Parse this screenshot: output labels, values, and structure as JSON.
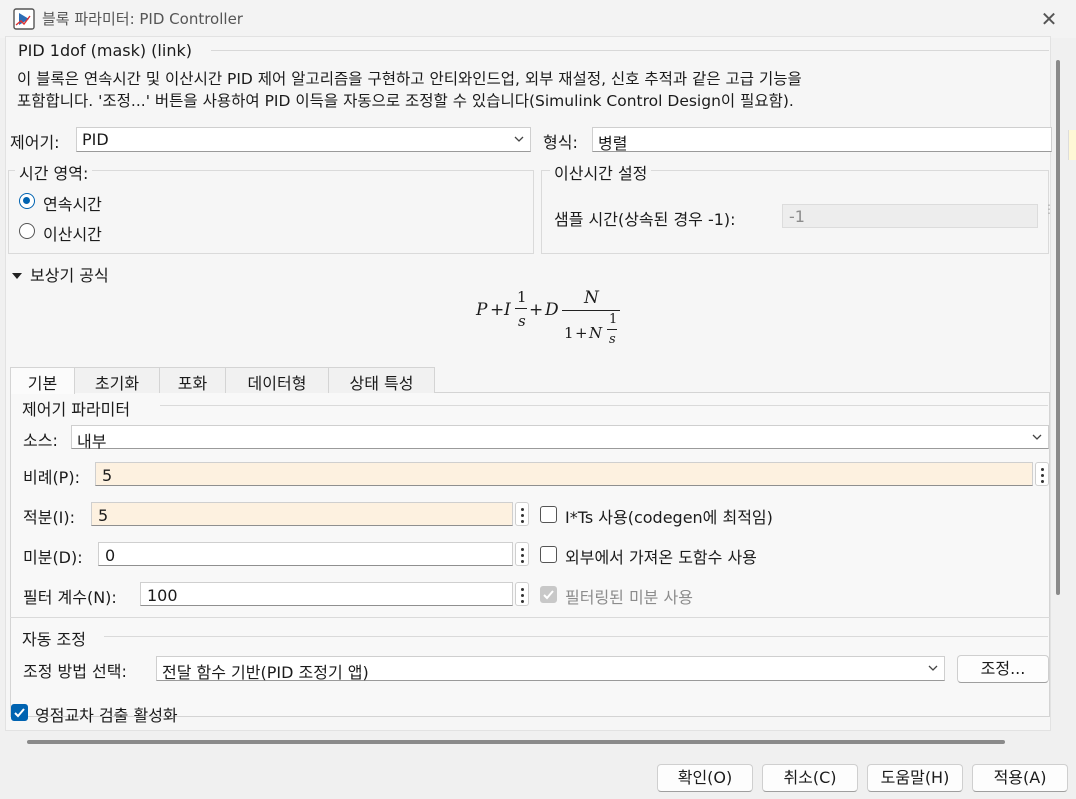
{
  "window": {
    "title": "블록 파라미터: PID Controller",
    "icon": "simulink-block-icon",
    "close_icon": "close-icon"
  },
  "header": {
    "block_name": "PID 1dof (mask) (link)",
    "description_line1": "이 블록은 연속시간 및 이산시간 PID 제어 알고리즘을 구현하고 안티와인드업, 외부 재설정, 신호 추적과 같은 고급 기능을",
    "description_line2": "포함합니다. '조정...' 버튼을 사용하여 PID 이득을 자동으로 조정할 수 있습니다(Simulink Control Design이 필요함)."
  },
  "controller": {
    "label": "제어기:",
    "value": "PID",
    "form_label": "형식:",
    "form_value": "병렬"
  },
  "time_domain": {
    "title": "시간 영역:",
    "options": [
      "연속시간",
      "이산시간"
    ],
    "selected": "연속시간"
  },
  "discrete_settings": {
    "title": "이산시간 설정",
    "sample_time_label": "샘플 시간(상속된 경우 -1):",
    "sample_time_value": "-1"
  },
  "compensator": {
    "title": "보상기 공식",
    "formula": {
      "p": "P",
      "plus1": "+",
      "i": "I",
      "one1": "1",
      "s1": "s",
      "plus2": "+",
      "d": "D",
      "n_top": "N",
      "den_one": "1",
      "den_plus": "+",
      "den_n": "N",
      "one2": "1",
      "s2": "s"
    }
  },
  "tabs": [
    "기본",
    "초기화",
    "포화",
    "데이터형",
    "상태 특성"
  ],
  "active_tab": "기본",
  "params": {
    "title": "제어기 파라미터",
    "source_label": "소스:",
    "source_value": "내부",
    "p_label": "비례(P):",
    "p_value": "5",
    "i_label": "적분(I):",
    "i_value": "5",
    "d_label": "미분(D):",
    "d_value": "0",
    "n_label": "필터 계수(N):",
    "n_value": "100",
    "ts_check_label": "I*Ts 사용(codegen에 최적임)",
    "ts_checked": false,
    "ext_deriv_label": "외부에서 가져온 도함수 사용",
    "ext_deriv_checked": false,
    "filtered_deriv_label": "필터링된 미분 사용",
    "filtered_deriv_checked": true
  },
  "autotune": {
    "title": "자동 조정",
    "method_label": "조정 방법 선택:",
    "method_value": "전달 함수 기반(PID 조정기 앱)",
    "tune_button": "조정..."
  },
  "zero_crossing": {
    "label": "영점교차 검출 활성화",
    "checked": true
  },
  "buttons": {
    "ok": "확인(O)",
    "cancel": "취소(C)",
    "help": "도움말(H)",
    "apply": "적용(A)"
  },
  "colors": {
    "accent": "#0063b1",
    "highlight_field": "#fdf1e0"
  }
}
